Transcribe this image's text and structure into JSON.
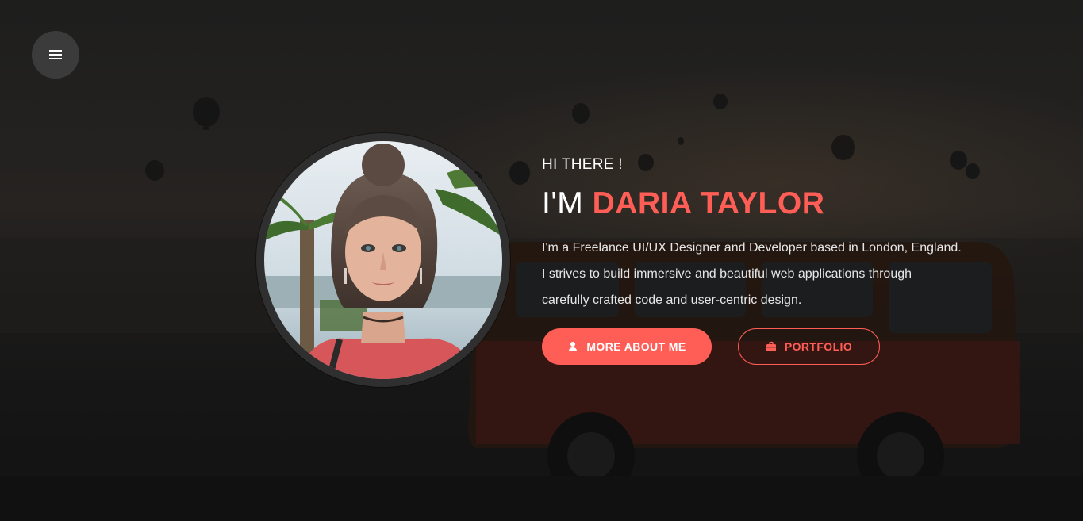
{
  "nav": {
    "menu_icon": "hamburger-menu-icon"
  },
  "profile": {
    "photo_alt": "Daria Taylor portrait"
  },
  "intro": {
    "greeting": "HI THERE !",
    "headline_prefix": "I'M",
    "name": "DARIA TAYLOR",
    "bio_lines": [
      "I'm a Freelance UI/UX Designer and Developer based in London, England.",
      "I strives to build immersive and beautiful web applications through",
      "carefully crafted code and user-centric design."
    ]
  },
  "actions": {
    "about_label": "MORE ABOUT ME",
    "about_icon": "user-icon",
    "portfolio_label": "PORTFOLIO",
    "portfolio_icon": "briefcase-icon"
  },
  "colors": {
    "accent": "#ff5e57",
    "background": "#1b1b1b",
    "menu_button": "#3b3b3b",
    "avatar_ring": "#2f2f2f"
  }
}
